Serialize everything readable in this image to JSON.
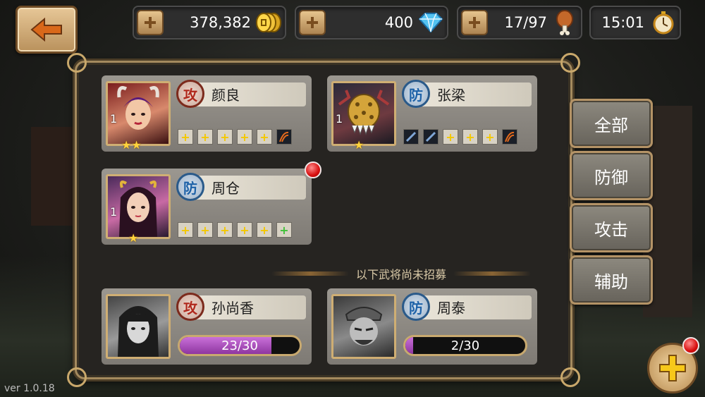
{
  "resources": {
    "gold": "378,382",
    "diamonds": "400",
    "stamina": "17/97",
    "timer": "15:01"
  },
  "icons": {
    "back": "back-arrow-icon",
    "gold": "gold-coins-icon",
    "diamond": "diamond-icon",
    "stamina": "meat-leg-icon",
    "timer": "stopwatch-icon",
    "add": "plus-icon"
  },
  "owned_heroes": [
    {
      "name": "颜良",
      "type": "攻",
      "level": "1",
      "stars": "★★",
      "slots": [
        "+",
        "+",
        "+",
        "+",
        "+",
        "gem"
      ],
      "alert": false
    },
    {
      "name": "张梁",
      "type": "防",
      "level": "1",
      "stars": "★",
      "slots": [
        "gem",
        "gem",
        "+",
        "+",
        "+",
        "gem"
      ],
      "alert": false
    },
    {
      "name": "周仓",
      "type": "防",
      "level": "1",
      "stars": "★",
      "slots": [
        "+",
        "+",
        "+",
        "+",
        "+",
        "+green"
      ],
      "alert": true
    }
  ],
  "divider_text": "以下武将尚未招募",
  "unrecruited_heroes": [
    {
      "name": "孙尚香",
      "type": "攻",
      "progress_text": "23/30",
      "progress": 0.7667
    },
    {
      "name": "周泰",
      "type": "防",
      "progress_text": "2/30",
      "progress": 0.0667
    }
  ],
  "filters": [
    "全部",
    "防御",
    "攻击",
    "辅助"
  ],
  "version": "ver 1.0.18",
  "colors": {
    "attack": "#b0281c",
    "defense": "#1e62a8",
    "progress": "#b35cc4",
    "frame_gold": "#c9a86b"
  }
}
